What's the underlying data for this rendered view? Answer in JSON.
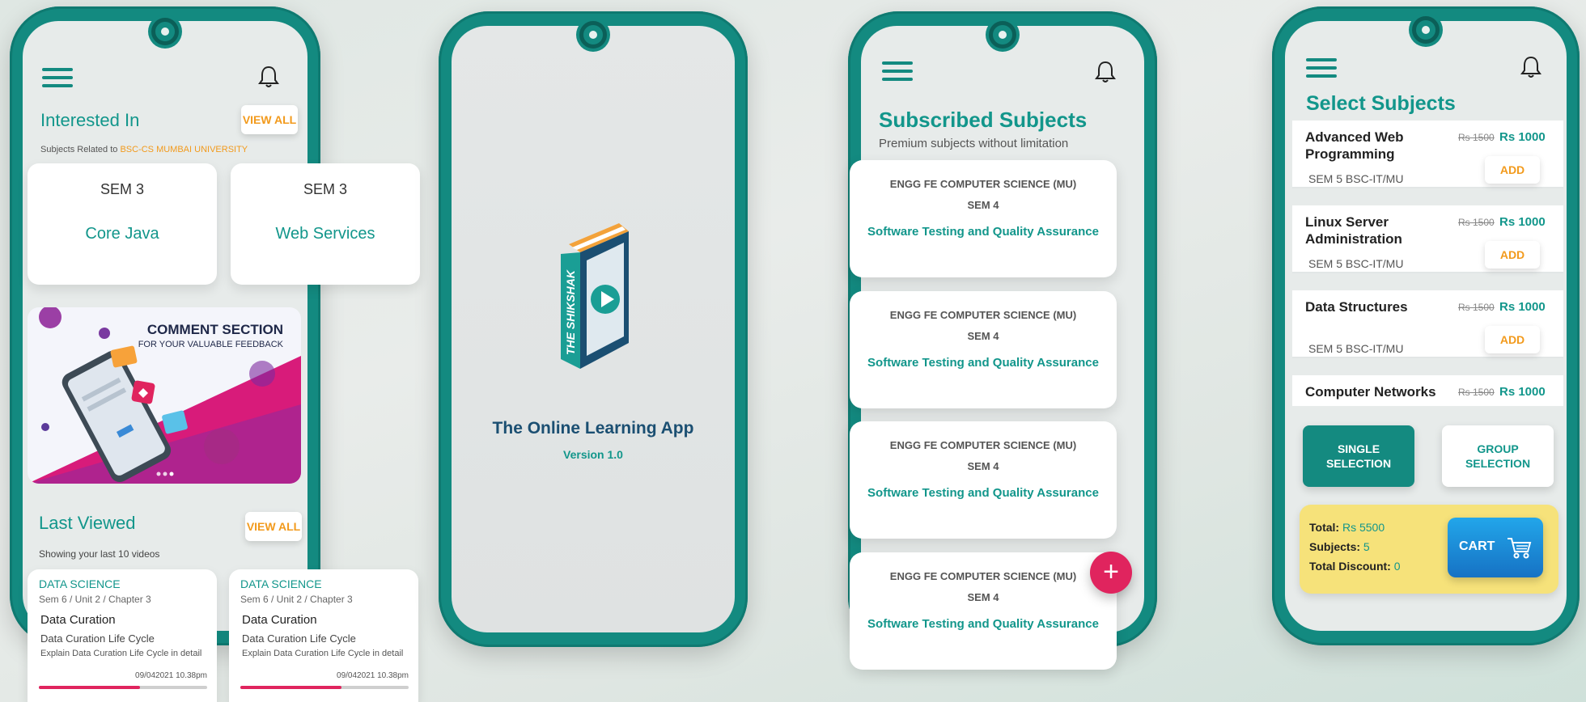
{
  "phone1": {
    "interested_title": "Interested In",
    "view_all": "VIEW ALL",
    "subtitle_prefix": "Subjects Related to ",
    "subtitle_highlight": "BSC-CS MUMBAI UNIVERSITY",
    "subjects": [
      {
        "sem": "SEM 3",
        "name": "Core Java"
      },
      {
        "sem": "SEM 3",
        "name": "Web Services"
      }
    ],
    "banner": {
      "title": "COMMENT SECTION",
      "subtitle": "FOR YOUR VALUABLE FEEDBACK"
    },
    "last_viewed_title": "Last Viewed",
    "last_viewed_view_all": "VIEW ALL",
    "last_viewed_subtitle": "Showing your last 10 videos",
    "videos": [
      {
        "category": "DATA SCIENCE",
        "path": "Sem 6 / Unit 2 / Chapter 3",
        "title": "Data Curation",
        "subtitle": "Data Curation Life Cycle",
        "desc": "Explain Data Curation Life Cycle in detail",
        "date": "09/042021 10.38pm",
        "progress": 0.6
      },
      {
        "category": "DATA SCIENCE",
        "path": "Sem 6 / Unit 2 / Chapter 3",
        "title": "Data Curation",
        "subtitle": "Data Curation Life Cycle",
        "desc": "Explain Data Curation Life Cycle in detail",
        "date": "09/042021 10.38pm",
        "progress": 0.6
      }
    ]
  },
  "phone2": {
    "book_spine": "THE SHIKSHAK",
    "app_title": "The Online Learning App",
    "version": "Version 1.0"
  },
  "phone3": {
    "title": "Subscribed Subjects",
    "subtitle": "Premium subjects without limitation",
    "cards": [
      {
        "course": "ENGG FE COMPUTER SCIENCE (MU)",
        "sem": "SEM 4",
        "subject": "Software Testing and Quality Assurance"
      },
      {
        "course": "ENGG FE COMPUTER SCIENCE (MU)",
        "sem": "SEM 4",
        "subject": "Software Testing and Quality Assurance"
      },
      {
        "course": "ENGG FE COMPUTER SCIENCE (MU)",
        "sem": "SEM 4",
        "subject": "Software Testing and Quality Assurance"
      },
      {
        "course": "ENGG FE COMPUTER SCIENCE (MU)",
        "sem": "SEM 4",
        "subject": "Software Testing and Quality Assurance"
      }
    ],
    "fab": "+"
  },
  "phone4": {
    "title": "Select Subjects",
    "subjects": [
      {
        "name": "Advanced Web Programming",
        "old_price": "Rs 1500",
        "price": "Rs 1000",
        "sem": "SEM 5 BSC-IT/MU",
        "add": "ADD"
      },
      {
        "name": "Linux Server Administration",
        "old_price": "Rs 1500",
        "price": "Rs 1000",
        "sem": "SEM 5 BSC-IT/MU",
        "add": "ADD"
      },
      {
        "name": "Data Structures",
        "old_price": "Rs 1500",
        "price": "Rs 1000",
        "sem": "SEM 5 BSC-IT/MU",
        "add": "ADD"
      },
      {
        "name": "Computer Networks",
        "old_price": "Rs 1500",
        "price": "Rs 1000",
        "sem": "",
        "add": ""
      }
    ],
    "single_selection": [
      "SINGLE",
      "SELECTION"
    ],
    "group_selection": [
      "GROUP",
      "SELECTION"
    ],
    "summary": {
      "total_label": "Total:",
      "total_value": "Rs 5500",
      "subjects_label": "Subjects:",
      "subjects_value": "5",
      "discount_label": "Total Discount:",
      "discount_value": "0"
    },
    "cart_label": "CART"
  },
  "colors": {
    "teal": "#12968b",
    "orange": "#f29a1c",
    "pink": "#e0245e",
    "cart_blue": "#1a86d8",
    "summary_yellow": "#f6e27a"
  }
}
